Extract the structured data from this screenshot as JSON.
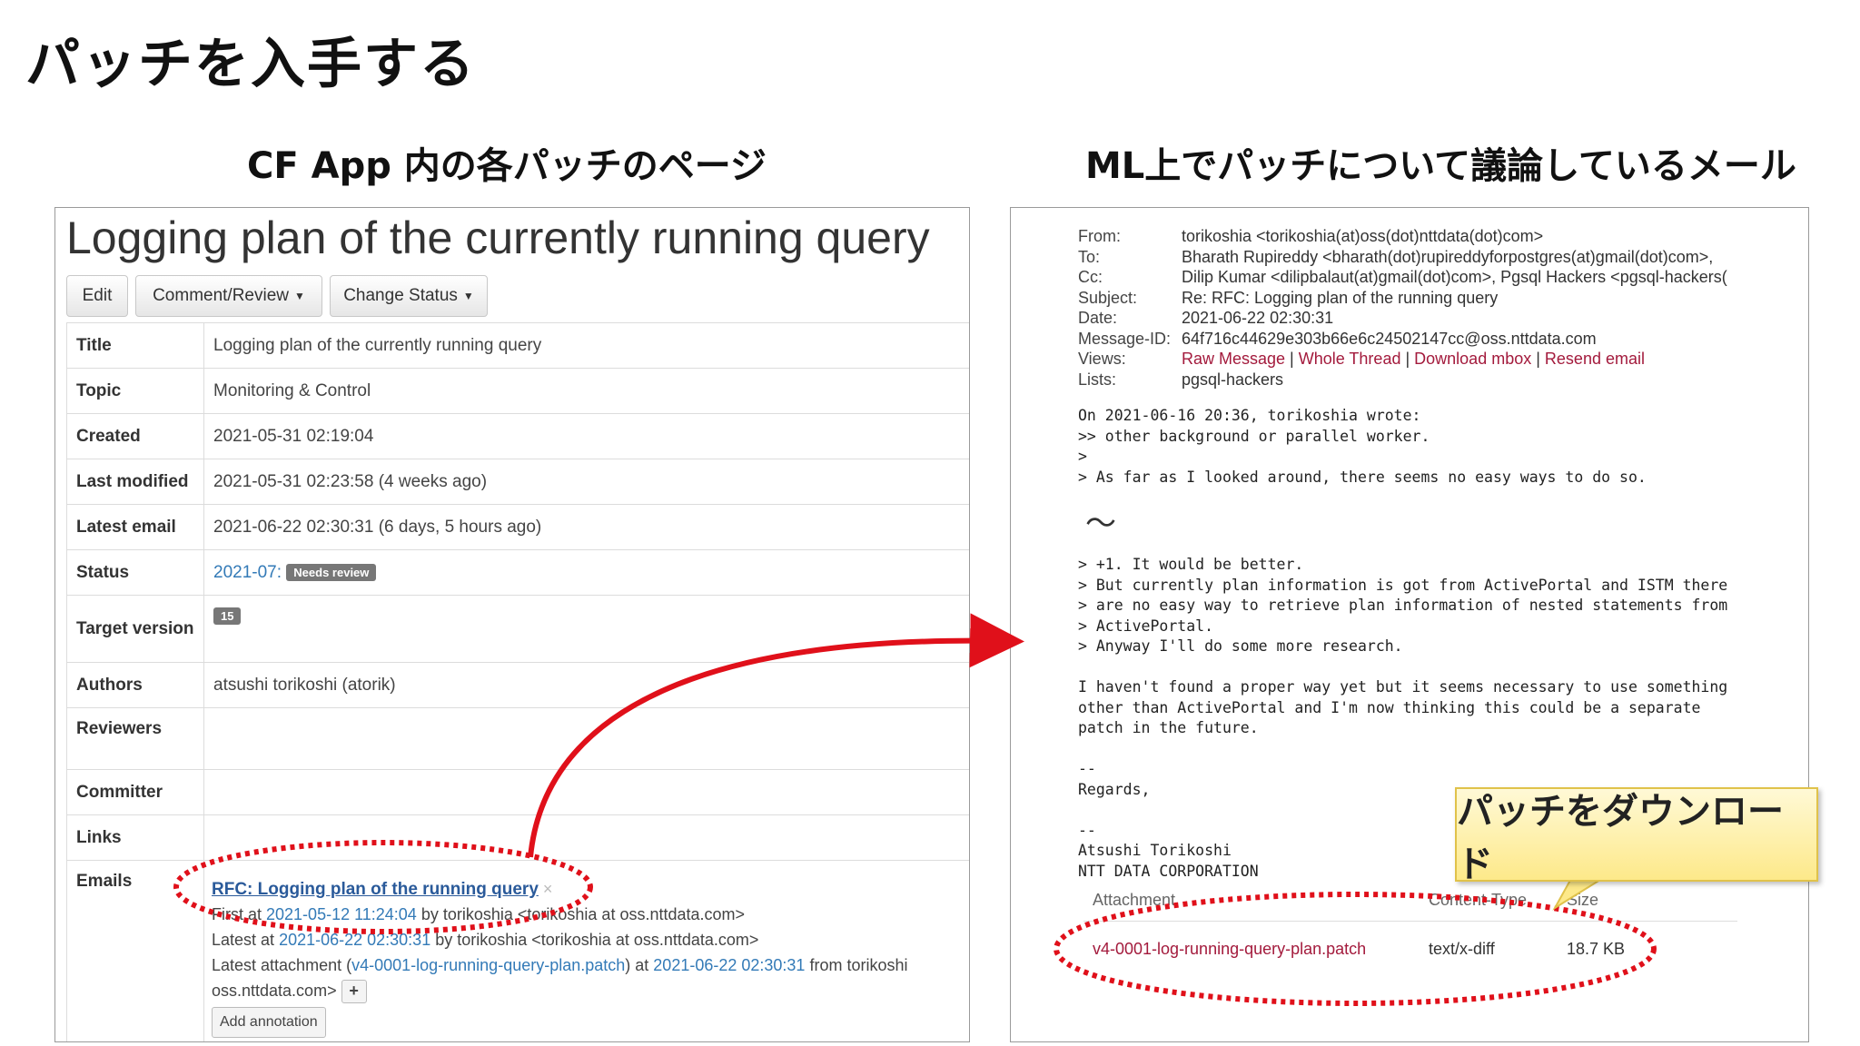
{
  "slide": {
    "title": "パッチを入手する",
    "left_caption": "CF App 内の各パッチのページ",
    "right_caption": "ML上でパッチについて議論しているメール",
    "callout": "パッチをダウンロード"
  },
  "cf_app": {
    "page_title": "Logging plan of the currently running query",
    "buttons": {
      "edit": "Edit",
      "comment": "Comment/Review",
      "status": "Change Status"
    },
    "labels": {
      "title": "Title",
      "topic": "Topic",
      "created": "Created",
      "last_modified": "Last modified",
      "latest_email": "Latest email",
      "status": "Status",
      "target": "Target version",
      "authors": "Authors",
      "reviewers": "Reviewers",
      "committer": "Committer",
      "links": "Links",
      "emails": "Emails"
    },
    "values": {
      "title": "Logging plan of the currently running query",
      "topic": "Monitoring & Control",
      "created": "2021-05-31 02:19:04",
      "last_modified": "2021-05-31 02:23:58 (4 weeks ago)",
      "latest_email": "2021-06-22 02:30:31 (6 days, 5 hours ago)",
      "status_link": "2021-07:",
      "status_badge": "Needs review",
      "target_badge": "15",
      "authors": "atsushi torikoshi (atorik)"
    },
    "emails": {
      "thread": "RFC: Logging plan of the running query",
      "close": "×",
      "first_prefix": "First at ",
      "first_date": "2021-05-12 11:24:04",
      "first_suffix": " by torikoshia <torikoshia at oss.nttdata.com>",
      "latest_prefix": "Latest at ",
      "latest_date": "2021-06-22 02:30:31",
      "latest_suffix": " by torikoshia <torikoshia at oss.nttdata.com>",
      "attach_prefix": "Latest attachment (",
      "attach_file": "v4-0001-log-running-query-plan.patch",
      "attach_mid": ") at ",
      "attach_date": "2021-06-22 02:30:31",
      "attach_suffix": " from torikoshi",
      "attach_cont": "oss.nttdata.com>",
      "plus": "+",
      "add_annotation": "Add annotation"
    }
  },
  "mail": {
    "headers": [
      {
        "k": "From:",
        "v": "torikoshia <torikoshia(at)oss(dot)nttdata(dot)com>"
      },
      {
        "k": "To:",
        "v": "Bharath Rupireddy <bharath(dot)rupireddyforpostgres(at)gmail(dot)com>,"
      },
      {
        "k": "Cc:",
        "v": "Dilip Kumar <dilipbalaut(at)gmail(dot)com>, Pgsql Hackers <pgsql-hackers("
      },
      {
        "k": "Subject:",
        "v": "Re: RFC: Logging plan of the running query"
      },
      {
        "k": "Date:",
        "v": "2021-06-22 02:30:31"
      }
    ],
    "message_id_label": "Message-ID:",
    "message_id": "64f716c44629e303b66e6c24502147cc@oss.nttdata.com",
    "views_label": "Views:",
    "views": [
      "Raw Message",
      "Whole Thread",
      "Download mbox",
      "Resend email"
    ],
    "lists_label": "Lists:",
    "list": "pgsql-hackers",
    "quote1": "On 2021-06-16 20:36, torikoshia wrote:\n>> other background or parallel worker.\n>\n> As far as I looked around, there seems no easy ways to do so.",
    "tilde": "〜",
    "quote2": "> +1. It would be better.\n> But currently plan information is got from ActivePortal and ISTM there\n> are no easy way to retrieve plan information of nested statements from\n> ActivePortal.\n> Anyway I'll do some more research.\n\nI haven't found a proper way yet but it seems necessary to use something\nother than ActivePortal and I'm now thinking this could be a separate\npatch in the future.\n\n--\nRegards,\n\n--\nAtsushi Torikoshi\nNTT DATA CORPORATION",
    "attachment": {
      "head_name": "Attachment",
      "head_type": "Content-Type",
      "head_size": "Size",
      "file": "v4-0001-log-running-query-plan.patch",
      "type": "text/x-diff",
      "size": "18.7 KB"
    }
  }
}
